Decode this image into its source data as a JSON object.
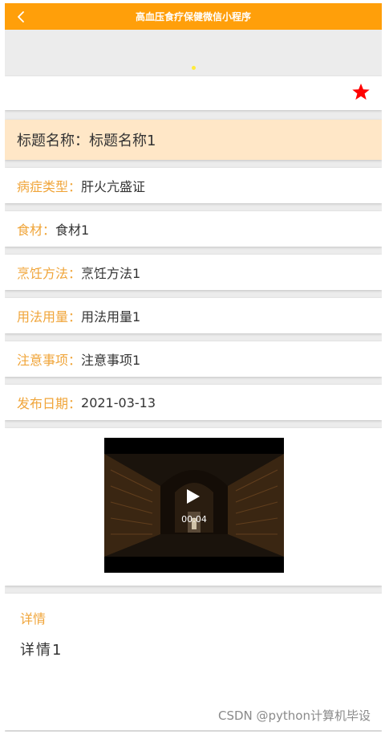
{
  "titlebar": {
    "title": "高血压食疗保健微信小程序",
    "back_icon": "chevron-left-icon"
  },
  "favorite": {
    "icon": "star-icon",
    "color": "#ff0000"
  },
  "title_row": {
    "label": "标题名称：",
    "value": "标题名称1"
  },
  "fields": [
    {
      "label": "病症类型：",
      "value": "肝火亢盛证"
    },
    {
      "label": "食材：",
      "value": "食材1"
    },
    {
      "label": "烹饪方法：",
      "value": "烹饪方法1"
    },
    {
      "label": "用法用量：",
      "value": "用法用量1"
    },
    {
      "label": "注意事项：",
      "value": "注意事项1"
    },
    {
      "label": "发布日期：",
      "value": "2021-03-13"
    }
  ],
  "video": {
    "duration": "00:04",
    "play_icon": "play-icon"
  },
  "detail": {
    "title": "详情",
    "body": "详情1"
  },
  "watermark": "CSDN @python计算机毕设",
  "colors": {
    "accent": "#ff9f0a",
    "label": "#f0a53a",
    "title_bg": "#ffe7c7",
    "star": "#ff0000"
  }
}
